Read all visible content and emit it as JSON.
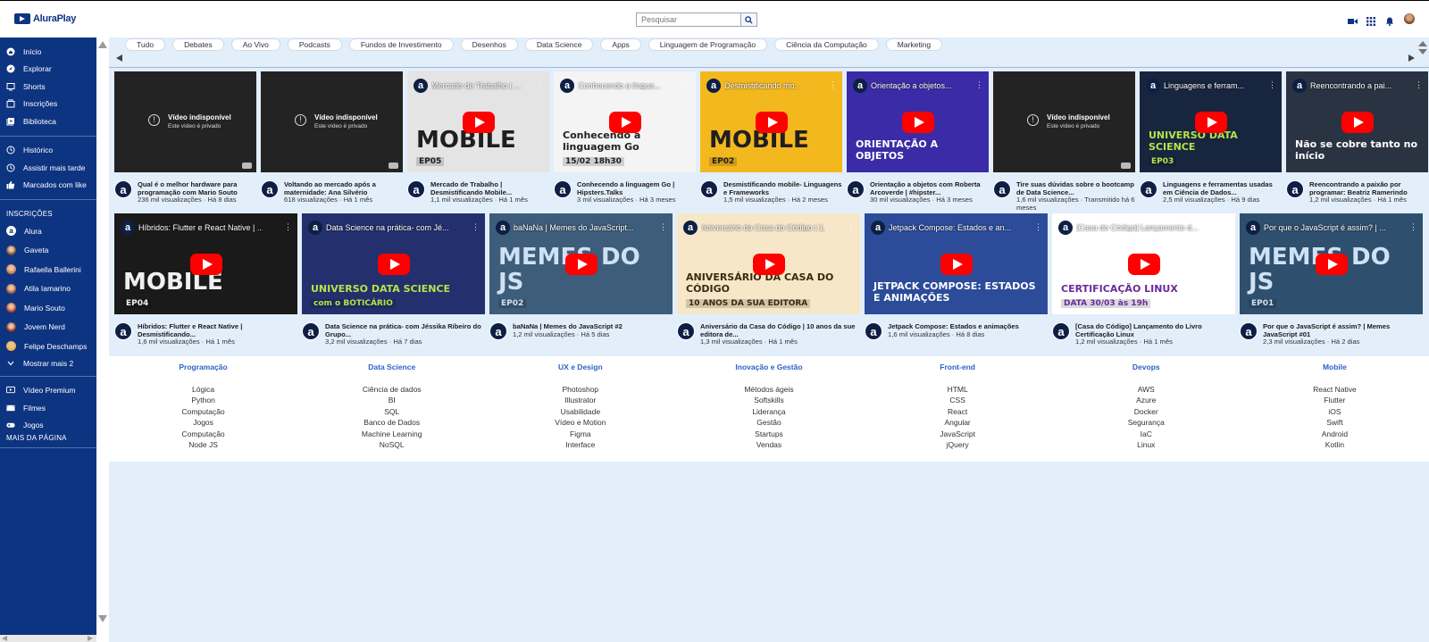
{
  "header": {
    "logo_text": "AluraPlay",
    "search_placeholder": "Pesquisar",
    "icons": [
      "add-video-icon",
      "apps-grid-icon",
      "notifications-bell-icon",
      "user-avatar"
    ]
  },
  "sidebar": {
    "main": [
      {
        "label": "Início",
        "icon": "home-icon"
      },
      {
        "label": "Explorar",
        "icon": "compass-icon"
      },
      {
        "label": "Shorts",
        "icon": "shorts-icon"
      },
      {
        "label": "Inscrições",
        "icon": "subscriptions-icon"
      },
      {
        "label": "Biblioteca",
        "icon": "library-icon"
      }
    ],
    "secondary": [
      {
        "label": "Histórico",
        "icon": "history-icon"
      },
      {
        "label": "Assistir mais tarde",
        "icon": "clock-icon"
      },
      {
        "label": "Marcados com like",
        "icon": "thumbs-up-icon"
      }
    ],
    "subs_heading": "INSCRIÇÕES",
    "subscriptions": [
      {
        "label": "Alura",
        "color": "#0d1f44"
      },
      {
        "label": "Gaveta",
        "color": "#6b4a2d"
      },
      {
        "label": "Rafaella Ballerini",
        "color": "#c47a52"
      },
      {
        "label": "Atila Iamarino",
        "color": "#a35a3a"
      },
      {
        "label": "Mario Souto",
        "color": "#b53a2a"
      },
      {
        "label": "Jovem Nerd",
        "color": "#7a3020"
      },
      {
        "label": "Felipe Deschamps",
        "color": "#e4b23c"
      }
    ],
    "show_more": "Mostrar mais 2",
    "extras": [
      {
        "label": "Vídeo Premium",
        "icon": "premium-icon"
      },
      {
        "label": "Filmes",
        "icon": "film-icon"
      },
      {
        "label": "Jogos",
        "icon": "gamepad-icon"
      }
    ],
    "more_label": "MAIS DA PÁGINA"
  },
  "chips": [
    "Tudo",
    "Debates",
    "Ao Vivo",
    "Podcasts",
    "Fundos de Investimento",
    "Desenhos",
    "Data Science",
    "Apps",
    "Linguagem de Programação",
    "Ciência da Computação",
    "Marketing"
  ],
  "unavailable": {
    "title": "Vídeo indisponível",
    "subtitle": "Este vídeo é privado"
  },
  "row1": [
    {
      "title": "Qual é o melhor hardware para programação com Mario Souto",
      "stats": "236 mil visualizações · Há 8 dias",
      "unavailable": true
    },
    {
      "title": "Voltando ao mercado após a maternidade: Ana Silvério",
      "stats": "618 visualizações · Há 1 mês",
      "unavailable": true
    },
    {
      "title": "Mercado de Trabalho | Desmistificando Mobile...",
      "stats": "1,1 mil visualizações · Há 1 mês",
      "thumb_title": "Mercado de Trabalho | ...",
      "bg": "#e4e4e4",
      "big": "MOBILE",
      "sub": "EP05",
      "bigcolor": "#1f1f1f"
    },
    {
      "title": "Conhecendo a linguagem Go | Hipsters.Talks",
      "stats": "3 mil visualizações · Há 3 meses",
      "thumb_title": "Conhecendo a lingua...",
      "bg": "#f4f4f4",
      "big": "Conhecendo a linguagem Go",
      "sub": "15/02 18h30",
      "bigcolor": "#222"
    },
    {
      "title": "Desmistificando mobile- Linguagens e Frameworks",
      "stats": "1,5 mil visualizações · Há 2 meses",
      "thumb_title": "Desmistificando mo...",
      "bg": "#f3b81e",
      "big": "MOBILE",
      "sub": "EP02",
      "bigcolor": "#1f1f1f"
    },
    {
      "title": "Orientação a objetos com Roberta Arcoverde | #hipster...",
      "stats": "30 mil visualizações · Há 3 meses",
      "thumb_title": "Orientação a objetos...",
      "bg": "#3b2ba6",
      "big": "ORIENTAÇÃO A OBJETOS",
      "sub": "",
      "bigcolor": "#ffffff"
    },
    {
      "title": "Tire suas dúvidas sobre o bootcamp de Data Science...",
      "stats": "1,6 mil visualizações · Transmitido há 6 meses",
      "unavailable": true
    },
    {
      "title": "Linguagens e ferramentas usadas em Ciência de Dados...",
      "stats": "2,5 mil visualizações · Há 9 dias",
      "thumb_title": "Linguagens e ferram...",
      "bg": "#18253e",
      "big": "UNIVERSO DATA SCIENCE",
      "sub": "EP03",
      "bigcolor": "#b6e34a"
    },
    {
      "title": "Reencontrando a paixão por programar: Beatriz Ramerindo",
      "stats": "1,2 mil visualizações · Há 1 mês",
      "thumb_title": "Reencontrando a pai...",
      "bg": "#2a3342",
      "big": "Não se cobre tanto no início",
      "sub": "",
      "bigcolor": "#ffffff"
    }
  ],
  "row2": [
    {
      "title": "Híbridos: Flutter e React Native | Desmistificando...",
      "stats": "1,6 mil visualizações · Há 1 mês",
      "thumb_title": "Híbridos: Flutter e React Native | ...",
      "bg": "#1a1a1a",
      "big": "MOBILE",
      "sub": "EP04",
      "bigcolor": "#f0f0f0"
    },
    {
      "title": "Data Science na prática- com Jéssika Ribeiro do Grupo...",
      "stats": "3,2 mil visualizações · Há 7 dias",
      "thumb_title": "Data Science na prática- com Jé...",
      "bg": "#24306d",
      "big": "UNIVERSO DATA SCIENCE",
      "sub": "com o BOTICÁRIO",
      "bigcolor": "#b6e34a"
    },
    {
      "title": "baNaNa | Memes do JavaScript #2",
      "stats": "1,2 mil visualizações · Há 5 dias",
      "thumb_title": "baNaNa | Memes do JavaScript...",
      "bg": "#3d5d7a",
      "big": "MEMES DO JS",
      "sub": "EP02",
      "bigcolor": "#cfe1f3"
    },
    {
      "title": "Aniversário da Casa do Código | 10 anos da sue editora de...",
      "stats": "1,3 mil visualizações · Há 1 mês",
      "thumb_title": "Aniversário da Casa do Código | 1...",
      "bg": "#f6e7c8",
      "big": "ANIVERSÁRIO DA CASA DO CÓDIGO",
      "sub": "10 ANOS DA SUA EDITORA",
      "bigcolor": "#3a2a10"
    },
    {
      "title": "Jetpack Compose: Estados e animações",
      "stats": "1,6 mil visualizações · Há 8 dias",
      "thumb_title": "Jetpack Compose: Estados e an...",
      "bg": "#2c4c9a",
      "big": "JETPACK COMPOSE: ESTADOS E ANIMAÇÕES",
      "sub": "",
      "bigcolor": "#ffffff"
    },
    {
      "title": "[Casa do Código] Lançamento do Livro Certificação Linux",
      "stats": "1,2 mil visualizações · Há 1 mês",
      "thumb_title": "[Casa do Código] Lançamento d...",
      "bg": "#ffffff",
      "big": "CERTIFICAÇÃO LINUX",
      "sub": "DATA 30/03 às 19h",
      "bigcolor": "#6a2a9c"
    },
    {
      "title": "Por que o JavaScript é assim? | Memes JavaScript #01",
      "stats": "2,3 mil visualizações · Há 2 dias",
      "thumb_title": "Por que o JavaScript é assim? | ...",
      "bg": "#2f4f6e",
      "big": "MEMES DO JS",
      "sub": "EP01",
      "bigcolor": "#cfe1f3"
    }
  ],
  "footer_cols": [
    {
      "heading": "Programação",
      "items": [
        "Lógica",
        "Python",
        "Computação",
        "Jogos",
        "Computação",
        "Node JS"
      ]
    },
    {
      "heading": "Data Science",
      "items": [
        "Ciência de dados",
        "BI",
        "SQL",
        "Banco de Dados",
        "Machine Learning",
        "NoSQL"
      ]
    },
    {
      "heading": "UX e Design",
      "items": [
        "Photoshop",
        "Illustrator",
        "Usabilidade",
        "Vídeo e Motion",
        "Figma",
        "Interface"
      ]
    },
    {
      "heading": "Inovação e Gestão",
      "items": [
        "Métodos ágeis",
        "Softskills",
        "Liderança",
        "Gestão",
        "Startups",
        "Vendas"
      ]
    },
    {
      "heading": "Front-end",
      "items": [
        "HTML",
        "CSS",
        "React",
        "Angular",
        "JavaScript",
        "jQuery"
      ]
    },
    {
      "heading": "Devops",
      "items": [
        "AWS",
        "Azure",
        "Docker",
        "Segurança",
        "IaC",
        "Linux"
      ]
    },
    {
      "heading": "Mobile",
      "items": [
        "React Native",
        "Flutter",
        "iOS",
        "Swift",
        "Android",
        "Kotlin"
      ]
    }
  ],
  "colors": {
    "sidebar": "#0d3480",
    "main_bg": "#e3eefb",
    "accent": "#2b63c9",
    "play": "#ff0000"
  }
}
